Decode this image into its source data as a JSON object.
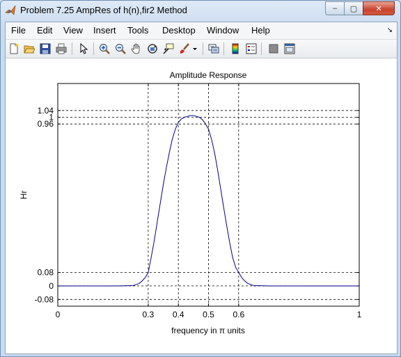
{
  "window": {
    "title": "Problem 7.25 AmpRes of h(n),fir2 Method",
    "minimize_glyph": "–",
    "maximize_glyph": "▢",
    "close_glyph": "✕"
  },
  "menu": {
    "items": [
      "File",
      "Edit",
      "View",
      "Insert",
      "Tools",
      "Desktop",
      "Window",
      "Help"
    ],
    "dock_glyph": "↘"
  },
  "toolbar": {
    "icons": [
      "new-figure-icon",
      "open-file-icon",
      "save-icon",
      "print-icon",
      "edit-plot-arrow-icon",
      "zoom-in-icon",
      "zoom-out-icon",
      "pan-hand-icon",
      "rotate-3d-icon",
      "data-cursor-icon",
      "brush-icon",
      "brush-dropdown-icon",
      "link-plot-icon",
      "colorbar-icon",
      "legend-icon",
      "hide-plot-tools-icon",
      "show-plot-tools-icon"
    ]
  },
  "colors": {
    "line": "#00008b",
    "grid": "#000000",
    "axes_bg": "#ffffff",
    "figure_bg": "#ffffff"
  },
  "chart_data": {
    "type": "line",
    "title": "Amplitude Response",
    "xlabel": "frequency in π units",
    "ylabel": "Hr",
    "xlim": [
      0,
      1
    ],
    "ylim": [
      -0.12,
      1.2
    ],
    "xticks": [
      0,
      0.3,
      0.4,
      0.5,
      0.6,
      1
    ],
    "xtick_labels": [
      "0",
      "0.3",
      "0.4",
      "0.5",
      "0.6",
      "1"
    ],
    "yticks": [
      -0.08,
      0,
      0.08,
      0.96,
      1,
      1.04
    ],
    "ytick_labels": [
      "-0.08",
      "0",
      "0.08",
      "0.96",
      "1",
      "1.04"
    ],
    "grid": true,
    "series": [
      {
        "x": [
          0,
          0.2,
          0.25,
          0.27,
          0.28,
          0.29,
          0.3,
          0.31,
          0.32,
          0.33,
          0.34,
          0.35,
          0.36,
          0.37,
          0.38,
          0.39,
          0.4,
          0.41,
          0.42,
          0.43,
          0.44,
          0.45,
          0.46,
          0.47,
          0.48,
          0.49,
          0.5,
          0.51,
          0.52,
          0.53,
          0.54,
          0.55,
          0.56,
          0.57,
          0.58,
          0.59,
          0.6,
          0.61,
          0.62,
          0.63,
          0.65,
          0.7,
          1.0
        ],
        "y": [
          0,
          0,
          0.002,
          0.015,
          0.03,
          0.05,
          0.08,
          0.17,
          0.27,
          0.38,
          0.49,
          0.6,
          0.7,
          0.79,
          0.87,
          0.93,
          0.97,
          0.99,
          1.0,
          1.005,
          1.01,
          1.01,
          1.005,
          1.0,
          0.985,
          0.96,
          0.93,
          0.87,
          0.79,
          0.69,
          0.58,
          0.47,
          0.36,
          0.26,
          0.17,
          0.11,
          0.08,
          0.05,
          0.03,
          0.015,
          0.002,
          0,
          0
        ]
      }
    ]
  }
}
